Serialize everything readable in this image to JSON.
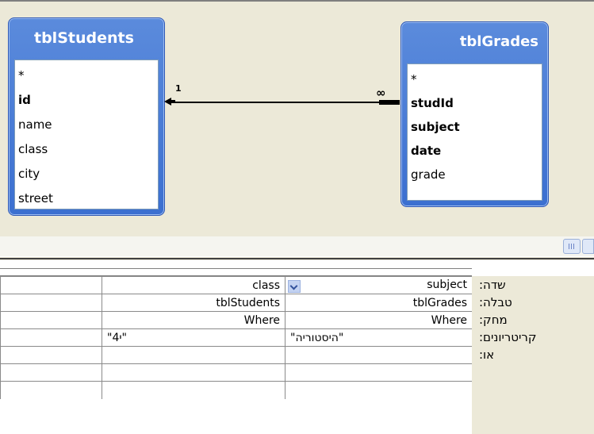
{
  "diagram": {
    "students": {
      "title": "tblStudents",
      "fields": [
        {
          "name": "*",
          "key": false
        },
        {
          "name": "id",
          "key": true
        },
        {
          "name": "name",
          "key": false
        },
        {
          "name": "class",
          "key": false
        },
        {
          "name": "city",
          "key": false
        },
        {
          "name": "street",
          "key": false
        }
      ]
    },
    "grades": {
      "title": "tblGrades",
      "fields": [
        {
          "name": "*",
          "key": false
        },
        {
          "name": "studId",
          "key": true
        },
        {
          "name": "subject",
          "key": true
        },
        {
          "name": "date",
          "key": true
        },
        {
          "name": "grade",
          "key": false
        }
      ]
    },
    "relationship": {
      "one_label": "1",
      "many_label": "∞"
    }
  },
  "grid": {
    "row_labels": [
      "שדה:",
      "טבלה:",
      "מחק:",
      "קריטריונים:",
      "או:"
    ],
    "columns": [
      {
        "field": "subject",
        "table": "tblGrades",
        "total": "Where",
        "criteria": "\"היסטוריה\"",
        "or": "",
        "has_dropdown": true
      },
      {
        "field": "class",
        "table": "tblStudents",
        "total": "Where",
        "criteria": "\"4י\"",
        "or": "",
        "has_dropdown": false
      }
    ]
  },
  "colors": {
    "table_header": "#3b6fd0",
    "background": "#ECE9D8"
  }
}
